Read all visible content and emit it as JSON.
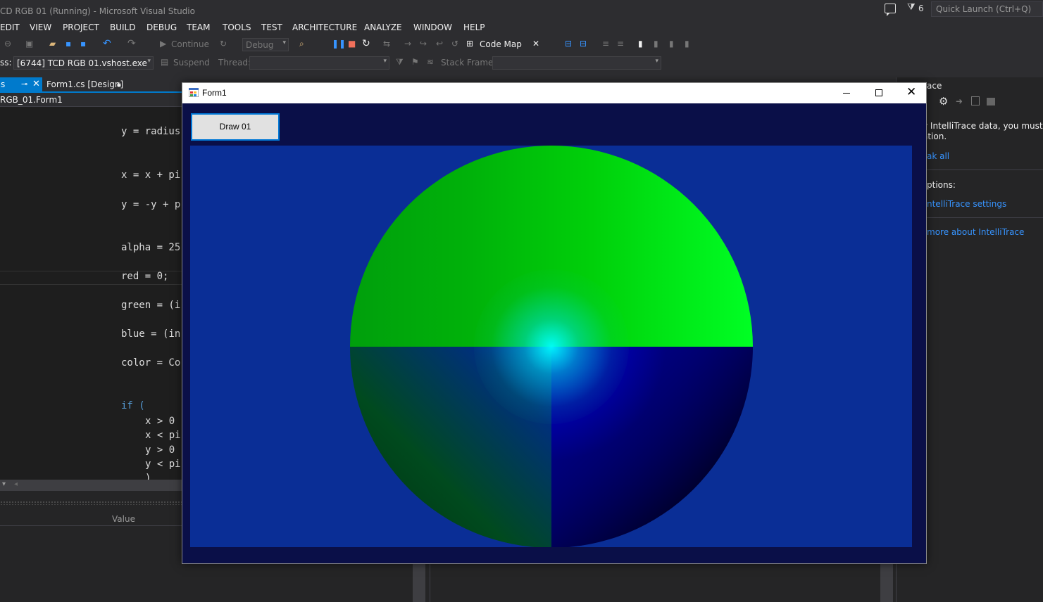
{
  "vs": {
    "title": "CD RGB 01 (Running) - Microsoft Visual Studio",
    "notification_count": "6",
    "quick_launch_placeholder": "Quick Launch (Ctrl+Q)"
  },
  "menu": [
    "EDIT",
    "VIEW",
    "PROJECT",
    "BUILD",
    "DEBUG",
    "TEAM",
    "TOOLS",
    "TEST",
    "ARCHITECTURE",
    "ANALYZE",
    "WINDOW",
    "HELP"
  ],
  "toolbar": {
    "continue_label": "Continue",
    "config_value": "Debug",
    "code_map_label": "Code Map",
    "process_label": "ss:",
    "process_value": "[6744] TCD RGB 01.vshost.exe",
    "suspend_label": "Suspend",
    "thread_label": "Thread:",
    "stack_frame_label": "Stack Frame:"
  },
  "tabs": {
    "active_label": "s",
    "form1_design": "Form1.cs [Design]"
  },
  "navbar": "RGB_01.Form1",
  "code": [
    {
      "indent": 0,
      "text": "y = radius"
    },
    {
      "indent": 0,
      "text": "x = x + pi"
    },
    {
      "indent": 0,
      "text": "y = -y + p"
    },
    {
      "indent": 0,
      "text": "alpha = 25"
    },
    {
      "indent": 0,
      "text": "red = 0;"
    },
    {
      "indent": 0,
      "text": "green = (i"
    },
    {
      "indent": 0,
      "text": "blue = (in"
    },
    {
      "indent": 0,
      "text": "color = Co"
    },
    {
      "indent": 0,
      "text": "if ("
    },
    {
      "indent": 1,
      "text": "x > 0"
    },
    {
      "indent": 1,
      "text": "x < pi"
    },
    {
      "indent": 1,
      "text": "y > 0"
    },
    {
      "indent": 1,
      "text": "y < pi"
    },
    {
      "indent": 1,
      "text": ")"
    }
  ],
  "bottom_panel": {
    "value_header": "Value"
  },
  "intellitrace": {
    "title": "ace",
    "message": "v IntelliTrace data, you must bre\nation.",
    "break_all_link": "ak all",
    "options_label": "ptions:",
    "settings_link": "ntelliTrace settings",
    "learn_more_link": "more about IntelliTrace"
  },
  "form1": {
    "title": "Form1",
    "draw_button": "Draw 01",
    "colors": {
      "client_bg": "#0a0f48",
      "canvas_bg": "#0a2e96",
      "button_border": "#0078d7"
    }
  }
}
